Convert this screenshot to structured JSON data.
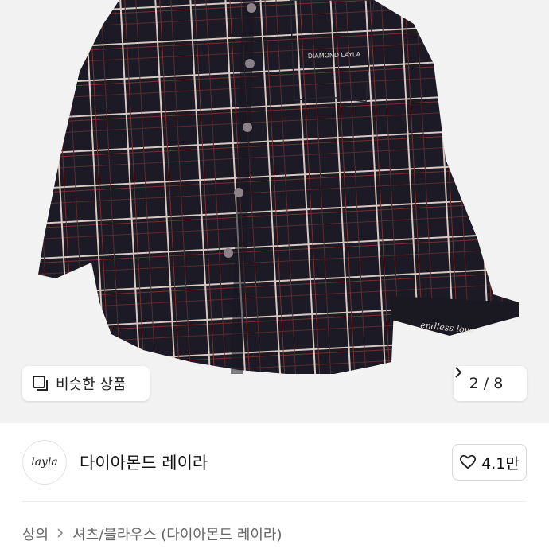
{
  "hero": {
    "similar_label": "비슷한 상품",
    "similar_icon": "similar-items-icon",
    "pager_text": "2 / 8",
    "pager_icon": "chevron-right-icon",
    "image_colors": {
      "fabric": "#1c1a24",
      "check_light": "#d8c8c0",
      "check_red": "#7a2e2c",
      "background": "#f2f2f2"
    },
    "pocket_text": "DIAMOND LAYLA",
    "cuff_text": "endless love"
  },
  "brand": {
    "logo_text": "layla",
    "name": "다이아몬드 레이라",
    "like_count": "4.1만",
    "like_icon": "heart-outline-icon"
  },
  "breadcrumb": {
    "items": [
      "상의",
      "셔츠/블라우스 (다이아몬드 레이라)"
    ],
    "separator_icon": "chevron-right-icon"
  }
}
